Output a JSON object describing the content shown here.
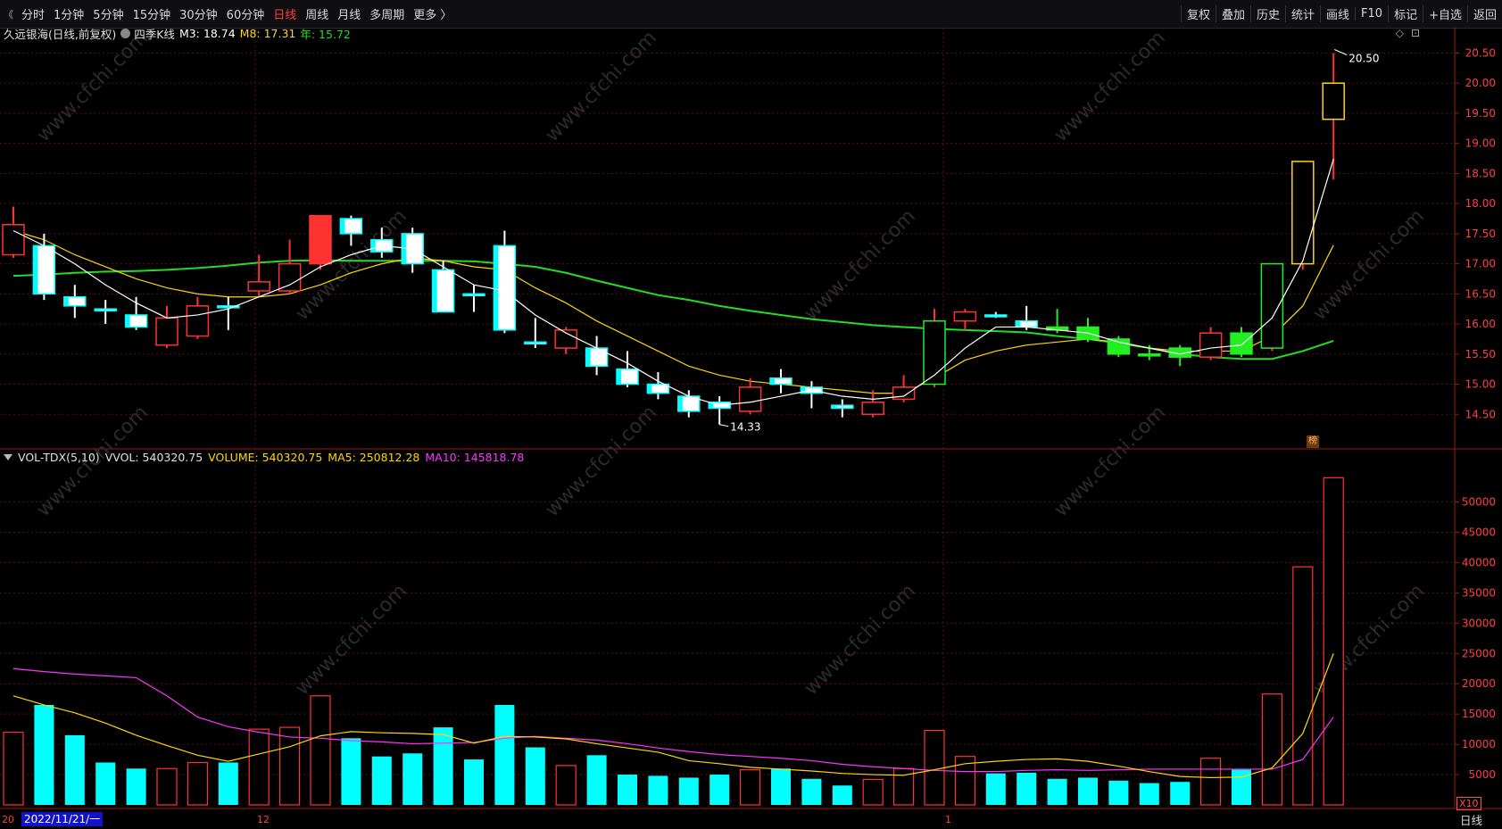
{
  "toolbar": {
    "back_symbol": "《",
    "periods": [
      "分时",
      "1分钟",
      "5分钟",
      "15分钟",
      "30分钟",
      "60分钟",
      "日线",
      "周线",
      "月线",
      "多周期",
      "更多 〉"
    ],
    "active_period": "日线",
    "right_buttons": [
      "复权",
      "叠加",
      "历史",
      "统计",
      "画线",
      "F10",
      "标记",
      "+自选",
      "返回"
    ]
  },
  "price_info": {
    "stock_name": "久远银海(日线,前复权)",
    "indicator_name": "四季K线",
    "m3_label": "M3: 18.74",
    "m8_label": "M8: 17.31",
    "year_label": "年: 15.72"
  },
  "volume_info": {
    "indicator": "VOL-TDX(5,10)",
    "vvol": "VVOL: 540320.75",
    "volume": "VOLUME: 540320.75",
    "ma5": "MA5: 250812.28",
    "ma10": "MA10: 145818.78"
  },
  "colors": {
    "up": "#ff3232",
    "down": "#00ffff",
    "m3": "#ffffff",
    "m8": "#ffd700",
    "year": "#22dd22",
    "ma5": "#ffd700",
    "ma10": "#ff33ff"
  },
  "chart_data": [
    {
      "type": "candlestick",
      "title": "久远银海(日线,前复权)",
      "ylim": [
        14.0,
        20.7
      ],
      "y_ticks": [
        "20.50",
        "20.00",
        "19.50",
        "19.00",
        "18.50",
        "18.00",
        "17.50",
        "17.00",
        "16.50",
        "16.00",
        "15.50",
        "15.00",
        "14.50"
      ],
      "annotations": {
        "high": "20.50",
        "low": "14.33"
      },
      "candles": [
        {
          "o": 17.15,
          "c": 17.65,
          "h": 17.95,
          "l": 17.1,
          "v": 12000
        },
        {
          "o": 17.3,
          "c": 16.5,
          "h": 17.5,
          "l": 16.4,
          "v": 16500
        },
        {
          "o": 16.45,
          "c": 16.3,
          "h": 16.65,
          "l": 16.1,
          "v": 11500
        },
        {
          "o": 16.25,
          "c": 16.25,
          "h": 16.4,
          "l": 16.0,
          "v": 7000
        },
        {
          "o": 16.15,
          "c": 15.95,
          "h": 16.45,
          "l": 15.9,
          "v": 6000
        },
        {
          "o": 15.65,
          "c": 16.1,
          "h": 16.3,
          "l": 15.6,
          "v": 6000
        },
        {
          "o": 15.8,
          "c": 16.3,
          "h": 16.45,
          "l": 15.75,
          "v": 7000
        },
        {
          "o": 16.3,
          "c": 16.3,
          "h": 16.45,
          "l": 15.9,
          "v": 7000
        },
        {
          "o": 16.55,
          "c": 16.7,
          "h": 17.15,
          "l": 16.45,
          "v": 12500
        },
        {
          "o": 16.55,
          "c": 17.0,
          "h": 17.4,
          "l": 16.5,
          "v": 12800
        },
        {
          "o": 17.0,
          "c": 17.8,
          "h": 17.8,
          "l": 16.9,
          "v": 18000
        },
        {
          "o": 17.75,
          "c": 17.5,
          "h": 17.8,
          "l": 17.3,
          "v": 11000
        },
        {
          "o": 17.4,
          "c": 17.2,
          "h": 17.6,
          "l": 17.1,
          "v": 8000
        },
        {
          "o": 17.5,
          "c": 17.0,
          "h": 17.6,
          "l": 16.85,
          "v": 8500
        },
        {
          "o": 16.9,
          "c": 16.2,
          "h": 17.05,
          "l": 16.2,
          "v": 12800
        },
        {
          "o": 16.5,
          "c": 16.5,
          "h": 16.65,
          "l": 16.2,
          "v": 7500
        },
        {
          "o": 17.3,
          "c": 15.9,
          "h": 17.55,
          "l": 15.85,
          "v": 16500
        },
        {
          "o": 15.7,
          "c": 15.7,
          "h": 16.1,
          "l": 15.6,
          "v": 9500
        },
        {
          "o": 15.6,
          "c": 15.9,
          "h": 15.95,
          "l": 15.5,
          "v": 6500
        },
        {
          "o": 15.6,
          "c": 15.3,
          "h": 15.8,
          "l": 15.15,
          "v": 8200
        },
        {
          "o": 15.25,
          "c": 15.0,
          "h": 15.55,
          "l": 14.95,
          "v": 5000
        },
        {
          "o": 15.0,
          "c": 14.85,
          "h": 15.2,
          "l": 14.75,
          "v": 4800
        },
        {
          "o": 14.8,
          "c": 14.55,
          "h": 14.9,
          "l": 14.45,
          "v": 4500
        },
        {
          "o": 14.7,
          "c": 14.6,
          "h": 14.8,
          "l": 14.33,
          "v": 5000
        },
        {
          "o": 14.55,
          "c": 14.95,
          "h": 15.1,
          "l": 14.5,
          "v": 5800
        },
        {
          "o": 15.1,
          "c": 15.0,
          "h": 15.25,
          "l": 14.85,
          "v": 6000
        },
        {
          "o": 14.95,
          "c": 14.85,
          "h": 15.05,
          "l": 14.6,
          "v": 4300
        },
        {
          "o": 14.65,
          "c": 14.6,
          "h": 14.75,
          "l": 14.45,
          "v": 3200
        },
        {
          "o": 14.5,
          "c": 14.7,
          "h": 14.9,
          "l": 14.45,
          "v": 4200
        },
        {
          "o": 14.75,
          "c": 14.95,
          "h": 15.15,
          "l": 14.7,
          "v": 6000
        },
        {
          "o": 15.0,
          "c": 16.05,
          "h": 16.25,
          "l": 14.95,
          "v": 12300
        },
        {
          "o": 16.05,
          "c": 16.2,
          "h": 16.25,
          "l": 15.9,
          "v": 8000
        },
        {
          "o": 16.15,
          "c": 16.15,
          "h": 16.2,
          "l": 16.1,
          "v": 5200
        },
        {
          "o": 16.05,
          "c": 15.95,
          "h": 16.3,
          "l": 15.9,
          "v": 5300
        },
        {
          "o": 15.95,
          "c": 15.9,
          "h": 16.25,
          "l": 15.85,
          "v": 4300
        },
        {
          "o": 15.95,
          "c": 15.75,
          "h": 16.1,
          "l": 15.7,
          "v": 4500
        },
        {
          "o": 15.75,
          "c": 15.5,
          "h": 15.8,
          "l": 15.45,
          "v": 4000
        },
        {
          "o": 15.5,
          "c": 15.5,
          "h": 15.65,
          "l": 15.4,
          "v": 3600
        },
        {
          "o": 15.6,
          "c": 15.45,
          "h": 15.65,
          "l": 15.3,
          "v": 3800
        },
        {
          "o": 15.45,
          "c": 15.85,
          "h": 15.95,
          "l": 15.4,
          "v": 7700
        },
        {
          "o": 15.85,
          "c": 15.5,
          "h": 15.95,
          "l": 15.45,
          "v": 5800
        },
        {
          "o": 15.6,
          "c": 17.0,
          "h": 17.0,
          "l": 15.55,
          "v": 18300
        },
        {
          "o": 17.0,
          "c": 18.7,
          "h": 18.7,
          "l": 16.9,
          "v": 39300
        },
        {
          "o": 19.4,
          "c": 20.0,
          "h": 20.5,
          "l": 18.4,
          "v": 54000
        }
      ],
      "m3": [
        17.55,
        17.3,
        17.0,
        16.65,
        16.35,
        16.1,
        16.15,
        16.25,
        16.45,
        16.65,
        16.95,
        17.15,
        17.3,
        17.25,
        16.95,
        16.65,
        16.55,
        16.15,
        15.85,
        15.6,
        15.35,
        15.05,
        14.8,
        14.65,
        14.7,
        14.8,
        14.9,
        14.8,
        14.75,
        14.8,
        15.15,
        15.6,
        15.95,
        15.95,
        15.9,
        15.85,
        15.7,
        15.6,
        15.5,
        15.6,
        15.65,
        16.1,
        17.05,
        18.74
      ],
      "m8": [
        17.55,
        17.4,
        17.15,
        16.95,
        16.75,
        16.6,
        16.5,
        16.45,
        16.45,
        16.5,
        16.65,
        16.85,
        17.0,
        17.1,
        17.05,
        16.95,
        16.9,
        16.6,
        16.35,
        16.05,
        15.8,
        15.55,
        15.3,
        15.15,
        15.05,
        15.0,
        14.95,
        14.9,
        14.85,
        14.85,
        15.1,
        15.4,
        15.55,
        15.65,
        15.7,
        15.75,
        15.7,
        15.6,
        15.55,
        15.55,
        15.55,
        15.8,
        16.3,
        17.31
      ],
      "year": [
        16.8,
        16.82,
        16.85,
        16.87,
        16.88,
        16.9,
        16.93,
        16.97,
        17.02,
        17.05,
        17.06,
        17.05,
        17.05,
        17.05,
        17.05,
        17.04,
        17.0,
        16.95,
        16.85,
        16.72,
        16.6,
        16.48,
        16.4,
        16.3,
        16.22,
        16.15,
        16.08,
        16.03,
        15.98,
        15.95,
        15.92,
        15.9,
        15.88,
        15.86,
        15.8,
        15.75,
        15.68,
        15.6,
        15.5,
        15.45,
        15.42,
        15.42,
        15.55,
        15.72
      ]
    },
    {
      "type": "bar",
      "title": "VOL-TDX(5,10)",
      "ylim": [
        0,
        57000
      ],
      "y_ticks": [
        "50000",
        "45000",
        "40000",
        "35000",
        "30000",
        "25000",
        "20000",
        "15000",
        "10000",
        "5000"
      ],
      "unit_label": "X10",
      "ma5": [
        18000,
        16500,
        15200,
        13500,
        11500,
        9800,
        8200,
        7200,
        8400,
        9600,
        11400,
        12100,
        11900,
        11800,
        11600,
        10200,
        11300,
        11200,
        10900,
        10100,
        9400,
        8700,
        7300,
        6800,
        6200,
        5900,
        5600,
        5200,
        5000,
        4900,
        5800,
        6800,
        7200,
        7500,
        7600,
        7200,
        6400,
        5500,
        4700,
        4500,
        4600,
        6100,
        11800,
        25000
      ],
      "ma10": [
        22500,
        22000,
        21600,
        21300,
        21000,
        18000,
        14500,
        12900,
        12000,
        11200,
        11000,
        10600,
        10400,
        10100,
        10200,
        10300,
        11000,
        11300,
        11000,
        10700,
        10100,
        9400,
        8800,
        8300,
        8000,
        7700,
        7300,
        6700,
        6300,
        6000,
        5700,
        5500,
        5500,
        5700,
        5800,
        5700,
        5800,
        5900,
        5900,
        5900,
        5900,
        5900,
        7500,
        14500
      ]
    },
    {
      "type": "axis",
      "x_labels": [
        "20",
        "12",
        "1"
      ],
      "cursor_date": "2022/11/21/一"
    }
  ],
  "right_icons": {
    "a": "◇",
    "b": "⊡"
  },
  "misc": {
    "bang_label": "榜",
    "period_tab": "日线",
    "watermark": "www.cfchi.com"
  }
}
